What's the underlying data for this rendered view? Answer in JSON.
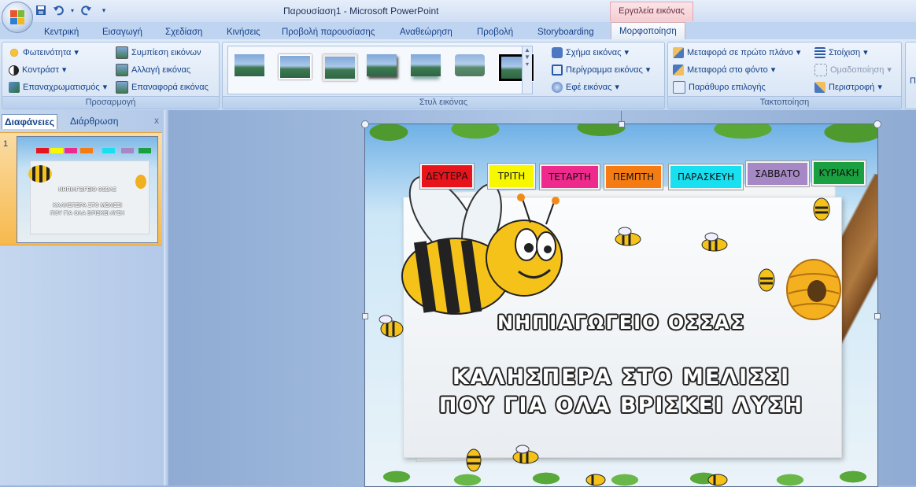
{
  "app": {
    "window_title": "Παρουσίαση1 - Microsoft PowerPoint",
    "contextual_header": "Εργαλεία εικόνας"
  },
  "qat": [
    "save-icon",
    "undo-icon",
    "dropdown-icon",
    "redo-icon",
    "customize-icon"
  ],
  "tabs": [
    {
      "label": "Κεντρική"
    },
    {
      "label": "Εισαγωγή"
    },
    {
      "label": "Σχεδίαση"
    },
    {
      "label": "Κινήσεις"
    },
    {
      "label": "Προβολή παρουσίασης"
    },
    {
      "label": "Αναθεώρηση"
    },
    {
      "label": "Προβολή"
    },
    {
      "label": "Storyboarding"
    },
    {
      "label": "Μορφοποίηση"
    }
  ],
  "ribbon": {
    "adjust": {
      "label": "Προσαρμογή",
      "brightness": "Φωτεινότητα",
      "contrast": "Κοντράστ",
      "recolor": "Επαναχρωματισμός",
      "compress": "Συμπίεση εικόνων",
      "change": "Αλλαγή εικόνας",
      "reset": "Επαναφορά εικόνας"
    },
    "styles": {
      "label": "Στυλ εικόνας",
      "shape": "Σχήμα εικόνας",
      "border": "Περίγραμμα εικόνας",
      "effects": "Εφέ εικόνας"
    },
    "arrange": {
      "label": "Τακτοποίηση",
      "front": "Μεταφορά σε πρώτο πλάνο",
      "back": "Μεταφορά στο φόντο",
      "selection": "Παράθυρο επιλογής",
      "align": "Στοίχιση",
      "group": "Ομαδοποίηση",
      "rotate": "Περιστροφή"
    },
    "size_partial": "Π"
  },
  "left_pane": {
    "tab_slides": "Διαφάνειες",
    "tab_outline": "Διάρθρωση",
    "close": "x",
    "slide_number": "1"
  },
  "slide": {
    "days": [
      {
        "label": "ΔΕΥΤΕΡΑ",
        "color": "#e8141c"
      },
      {
        "label": "ΤΡΙΤΗ",
        "color": "#f7f700"
      },
      {
        "label": "ΤΕΤΑΡΤΗ",
        "color": "#ee2a8c"
      },
      {
        "label": "ΠΕΜΠΤΗ",
        "color": "#f57c12"
      },
      {
        "label": "ΠΑΡΑΣΚΕΥΗ",
        "color": "#18e0f0"
      },
      {
        "label": "ΣΑΒΒΑΤΟ",
        "color": "#a688c6"
      },
      {
        "label": "ΚΥΡΙΑΚΗ",
        "color": "#1aa040"
      }
    ],
    "title": "ΝΗΠΙΑΓΩΓΕΙΟ ΟΣΣΑΣ",
    "line1": "ΚΑΛΗΣΠΕΡΑ ΣΤΟ ΜΕΛΙΣΣΙ",
    "line2": "ΠΟΥ ΓΙΑ ΟΛΑ ΒΡΙΣΚΕΙ ΛΥΣΗ"
  }
}
